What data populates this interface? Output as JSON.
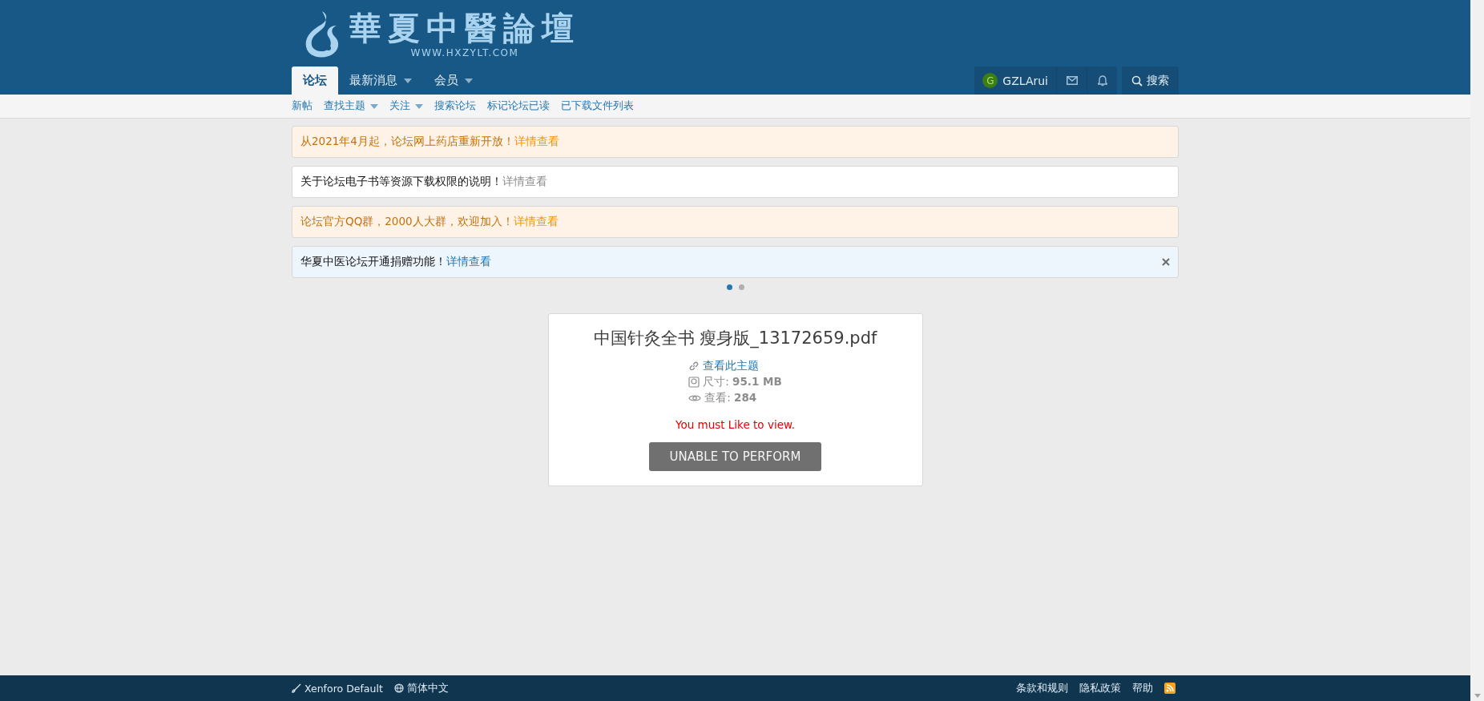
{
  "header": {
    "logo_title": "華夏中醫論壇",
    "logo_subtitle": "WWW.HXZYLT.COM"
  },
  "nav_tabs": [
    {
      "label": "论坛",
      "selected": true,
      "has_menu": false
    },
    {
      "label": "最新消息",
      "selected": false,
      "has_menu": true
    },
    {
      "label": "会员",
      "selected": false,
      "has_menu": true
    }
  ],
  "user": {
    "avatar_letter": "G",
    "name": "GZLArui"
  },
  "search_label": "搜索",
  "sub_nav": [
    {
      "label": "新帖",
      "has_menu": false
    },
    {
      "label": "查找主题",
      "has_menu": true
    },
    {
      "label": "关注",
      "has_menu": true
    },
    {
      "label": "搜索论坛",
      "has_menu": false
    },
    {
      "label": "标记论坛已读",
      "has_menu": false
    },
    {
      "label": "已下载文件列表",
      "has_menu": false
    }
  ],
  "notices": [
    {
      "kind": "warning",
      "text": "从2021年4月起，论坛网上药店重新开放！",
      "link": "详情查看",
      "dismissible": false
    },
    {
      "kind": "plain",
      "text": "关于论坛电子书等资源下载权限的说明！",
      "link": "详情查看",
      "dismissible": false
    },
    {
      "kind": "warning",
      "text": "论坛官方QQ群，2000人大群，欢迎加入！",
      "link": "详情查看",
      "dismissible": false
    },
    {
      "kind": "info",
      "text": "华夏中医论坛开通捐赠功能！",
      "link": "详情查看",
      "dismissible": true
    }
  ],
  "notice_pages": [
    {
      "selected": true
    },
    {
      "selected": false
    }
  ],
  "file_card": {
    "title": "中国针灸全书 瘦身版_13172659.pdf",
    "thread_link": "查看此主题",
    "size_label": "尺寸:",
    "size_value": "95.1 MB",
    "views_label": "查看:",
    "views_value": "284",
    "warning": "You must Like to view.",
    "button": "UNABLE TO PERFORM"
  },
  "footer": {
    "left": [
      {
        "kind": "style",
        "label": "Xenforo Default"
      },
      {
        "kind": "language",
        "label": "简体中文"
      }
    ],
    "right": [
      "条款和规则",
      "隐私政策",
      "帮助"
    ]
  }
}
